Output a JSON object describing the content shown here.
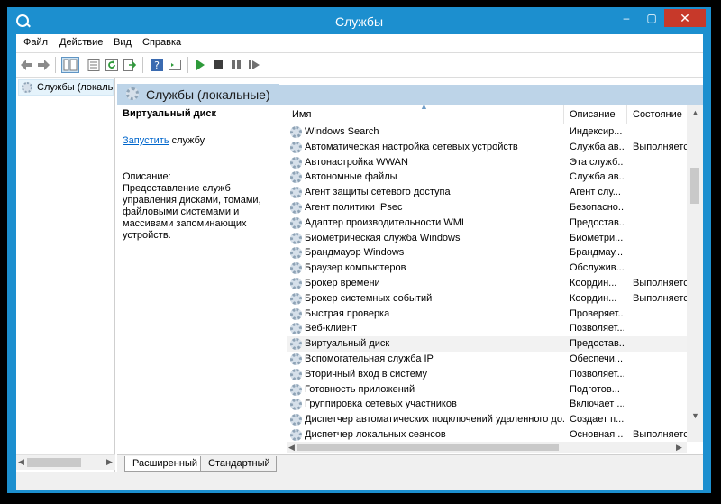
{
  "window": {
    "title": "Службы"
  },
  "titlebar": {
    "minimize": "–",
    "maximize": "▢",
    "close": "✕"
  },
  "menu": [
    "Файл",
    "Действие",
    "Вид",
    "Справка"
  ],
  "tree": {
    "item": "Службы (локальные)"
  },
  "pane": {
    "title": "Службы (локальные)"
  },
  "description": {
    "service_name": "Виртуальный диск",
    "start_link": "Запустить",
    "start_suffix": " службу",
    "label": "Описание:",
    "text": "Предоставление служб управления дисками, томами, файловыми системами и массивами запоминающих устройств."
  },
  "columns": {
    "name": "Имя",
    "description": "Описание",
    "state": "Состояние"
  },
  "services": [
    {
      "name": "Windows Search",
      "description": "Индексир...",
      "state": ""
    },
    {
      "name": "Автоматическая настройка сетевых устройств",
      "description": "Служба ав...",
      "state": "Выполняется"
    },
    {
      "name": "Автонастройка WWAN",
      "description": "Эта служб...",
      "state": ""
    },
    {
      "name": "Автономные файлы",
      "description": "Служба ав...",
      "state": ""
    },
    {
      "name": "Агент защиты сетевого доступа",
      "description": "Агент слу...",
      "state": ""
    },
    {
      "name": "Агент политики IPsec",
      "description": "Безопасно...",
      "state": ""
    },
    {
      "name": "Адаптер производительности WMI",
      "description": "Предостав...",
      "state": ""
    },
    {
      "name": "Биометрическая служба Windows",
      "description": "Биометри...",
      "state": ""
    },
    {
      "name": "Брандмауэр Windows",
      "description": "Брандмау...",
      "state": ""
    },
    {
      "name": "Браузер компьютеров",
      "description": "Обслужив...",
      "state": ""
    },
    {
      "name": "Брокер времени",
      "description": "Координ...",
      "state": "Выполняется"
    },
    {
      "name": "Брокер системных событий",
      "description": "Координ...",
      "state": "Выполняется"
    },
    {
      "name": "Быстрая проверка",
      "description": "Проверяет...",
      "state": ""
    },
    {
      "name": "Веб-клиент",
      "description": "Позволяет...",
      "state": ""
    },
    {
      "name": "Виртуальный диск",
      "description": "Предостав...",
      "state": ""
    },
    {
      "name": "Вспомогательная служба IP",
      "description": "Обеспечи...",
      "state": ""
    },
    {
      "name": "Вторичный вход в систему",
      "description": "Позволяет...",
      "state": ""
    },
    {
      "name": "Готовность приложений",
      "description": "Подготов...",
      "state": ""
    },
    {
      "name": "Группировка сетевых участников",
      "description": "Включает ...",
      "state": ""
    },
    {
      "name": "Диспетчер автоматических подключений удаленного до...",
      "description": "Создает п...",
      "state": ""
    },
    {
      "name": "Диспетчер локальных сеансов",
      "description": "Основная ...",
      "state": "Выполняется"
    }
  ],
  "selected_index": 14,
  "tabs": {
    "extended": "Расширенный",
    "standard": "Стандартный"
  }
}
